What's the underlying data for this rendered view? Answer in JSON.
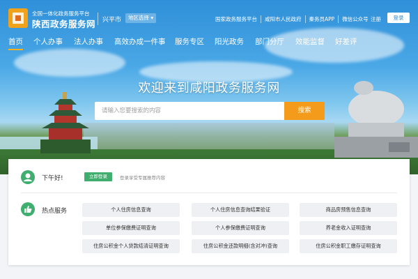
{
  "header": {
    "logo_sub": "全国一体化政务服务平台",
    "logo_main": "陕西政务服务网",
    "city": "兴平市",
    "region_select": "地区选择",
    "top_links": [
      "国家政务服务平台",
      "咸阳市人民政府",
      "秦务员APP",
      "微信公众号"
    ],
    "register": "注册",
    "login": "登录"
  },
  "nav": {
    "items": [
      "首页",
      "个人办事",
      "法人办事",
      "高效办成一件事",
      "服务专区",
      "阳光政务",
      "部门分厅",
      "效能监督",
      "好差评"
    ]
  },
  "hero": {
    "headline": "欢迎来到咸阳政务服务网",
    "search_placeholder": "请输入您要搜索的内容",
    "search_button": "搜索"
  },
  "greeting": {
    "text": "下午好!",
    "login_button": "立即登录",
    "tip": "登录享受专属推荐内容"
  },
  "hot_services": {
    "title": "热点服务",
    "items": [
      "个人住房信息查询",
      "个人住房信息查询结果验证",
      "商品房预售信息查询",
      "单位参保缴费证明查询",
      "个人参保缴费证明查询",
      "养老金收入证明查询",
      "住房公积金个人贷款结清证明查询",
      "住房公积金还款明细(含对冲)查询",
      "住房公积金职工缴存证明查询"
    ]
  },
  "colors": {
    "brand_blue": "#2f8fd8",
    "accent_orange": "#f49b1c",
    "green": "#3fae6e",
    "nav_underline": "#f7b11d"
  }
}
